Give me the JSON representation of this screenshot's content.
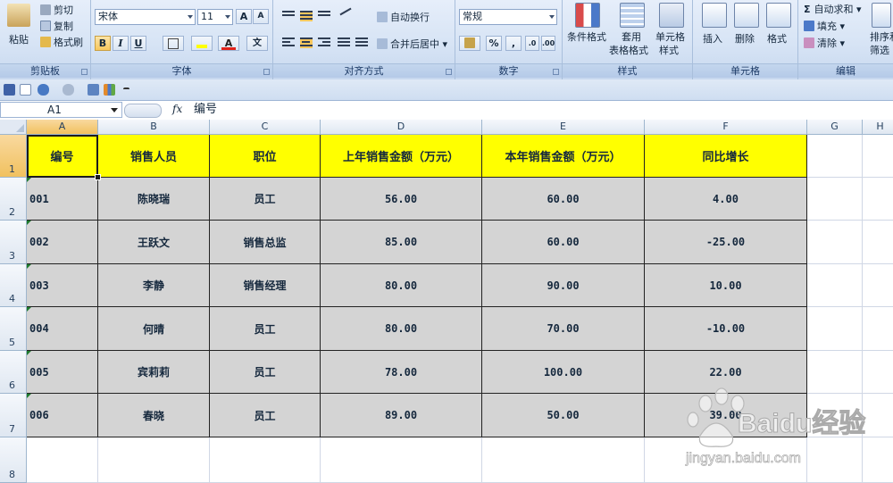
{
  "ribbon": {
    "clipboard": {
      "label": "剪贴板",
      "paste": "粘贴",
      "cut": "剪切",
      "copy": "复制",
      "format_painter": "格式刷"
    },
    "font": {
      "label": "字体",
      "name": "宋体",
      "size": "11"
    },
    "alignment": {
      "label": "对齐方式",
      "wrap": "自动换行",
      "merge": "合并后居中"
    },
    "number": {
      "label": "数字",
      "format": "常规",
      "percent": "%",
      "comma": ","
    },
    "styles": {
      "label": "样式",
      "conditional": "条件格式",
      "table_1": "套用",
      "table_2": "表格格式",
      "cell_style_1": "单元格",
      "cell_style_2": "样式"
    },
    "cells": {
      "label": "单元格",
      "insert": "插入",
      "delete": "删除",
      "format": "格式"
    },
    "editing": {
      "label": "编辑",
      "autosum": "自动求和",
      "fill": "填充",
      "clear": "清除",
      "sort_1": "排序和",
      "sort_2": "筛选"
    }
  },
  "formula_bar": {
    "name_box": "A1",
    "fx": "fx",
    "content": "编号"
  },
  "columns": [
    "A",
    "B",
    "C",
    "D",
    "E",
    "F",
    "G",
    "H"
  ],
  "rows": [
    "1",
    "2",
    "3",
    "4",
    "5",
    "6",
    "7",
    "8"
  ],
  "table": {
    "headers": [
      "编号",
      "销售人员",
      "职位",
      "上年销售金额（万元）",
      "本年销售金额（万元）",
      "同比增长"
    ],
    "rows": [
      [
        "001",
        "陈晓瑞",
        "员工",
        "56.00",
        "60.00",
        "4.00"
      ],
      [
        "002",
        "王跃文",
        "销售总监",
        "85.00",
        "60.00",
        "-25.00"
      ],
      [
        "003",
        "李静",
        "销售经理",
        "80.00",
        "90.00",
        "10.00"
      ],
      [
        "004",
        "何晴",
        "员工",
        "80.00",
        "70.00",
        "-10.00"
      ],
      [
        "005",
        "宾莉莉",
        "员工",
        "78.00",
        "100.00",
        "22.00"
      ],
      [
        "006",
        "春晓",
        "员工",
        "89.00",
        "50.00",
        "39.00"
      ]
    ]
  },
  "watermark": {
    "brand": "Baidu经验",
    "url": "jingyan.baidu.com"
  },
  "colors": {
    "header_fill": "#ffff00",
    "data_fill": "#d4d4d4",
    "selection": "#f1c15f"
  }
}
